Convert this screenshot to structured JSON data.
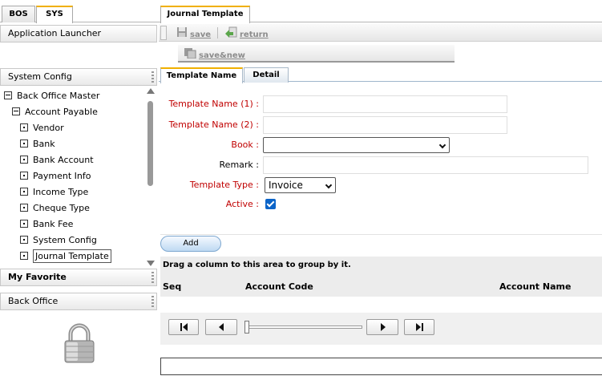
{
  "left_tabs": [
    {
      "label": "BOS",
      "active": false
    },
    {
      "label": "SYS",
      "active": true
    }
  ],
  "application_launcher": "Application Launcher",
  "system_config_header": "System Config",
  "tree": {
    "root": "Back Office Master",
    "group": "Account Payable",
    "items": [
      "Vendor",
      "Bank",
      "Bank Account",
      "Payment Info",
      "Income Type",
      "Cheque Type",
      "Bank Fee",
      "System Config",
      "Journal Template"
    ],
    "selected": "Journal Template"
  },
  "my_favorite": "My Favorite",
  "back_office": "Back Office",
  "main_tab": "Journal Template",
  "toolbar": {
    "save": "save",
    "return": "return",
    "save_new": "save&new"
  },
  "form_tabs": [
    {
      "label": "Template Name",
      "active": true
    },
    {
      "label": "Detail",
      "active": false
    }
  ],
  "form": {
    "template_name_1_label": "Template Name (1) :",
    "template_name_1_value": "",
    "template_name_2_label": "Template Name (2) :",
    "template_name_2_value": "",
    "book_label": "Book :",
    "book_value": "",
    "remark_label": "Remark :",
    "remark_value": "",
    "template_type_label": "Template Type :",
    "template_type_value": "Invoice",
    "active_label": "Active :",
    "active_checked": true
  },
  "add_button": "Add",
  "grid": {
    "group_hint": "Drag a column to this area to group by it.",
    "columns": [
      "Seq",
      "Account Code",
      "Account Name"
    ]
  },
  "colors": {
    "required_label": "#c00000",
    "tab_accent": "#f0b000",
    "checkbox": "#0b64c8"
  }
}
